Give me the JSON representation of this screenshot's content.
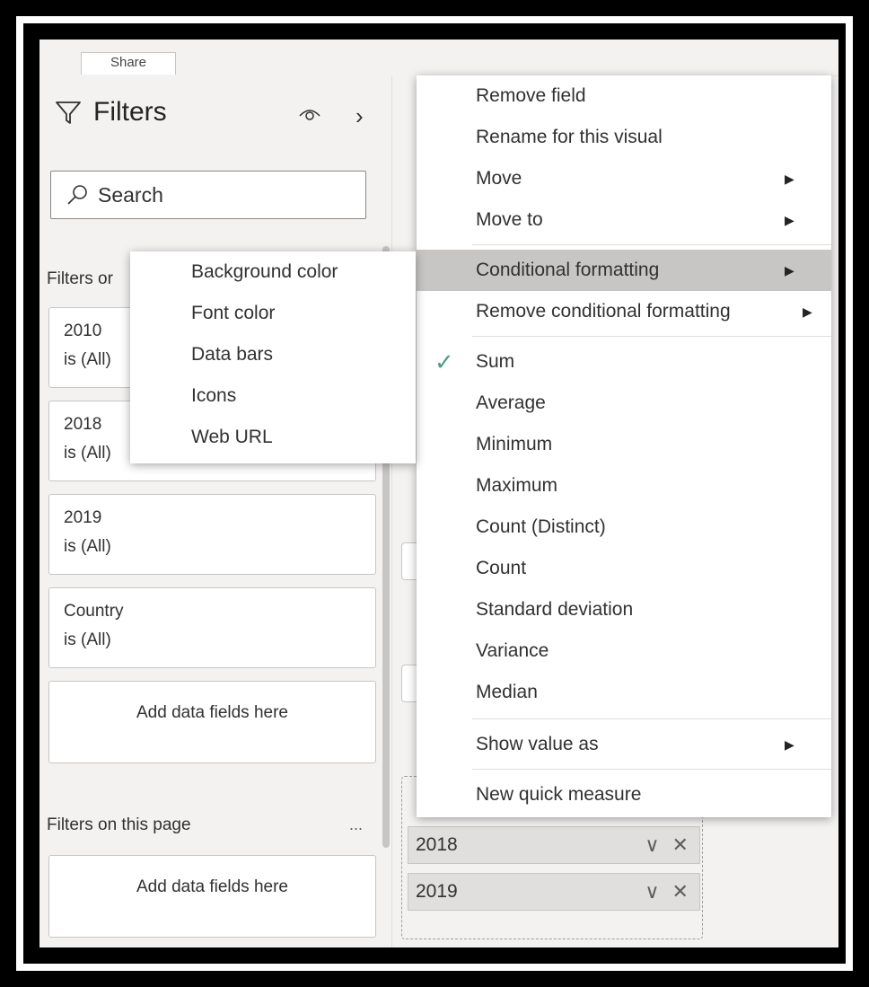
{
  "ribbon": {
    "share_tab": "Share"
  },
  "filters": {
    "title": "Filters",
    "search_placeholder": "Search",
    "section_visual": "Filters on this visual",
    "section_visual_visible": "Filters or",
    "cards": [
      {
        "field": "2010",
        "state": "is (All)"
      },
      {
        "field": "2018",
        "state": "is (All)"
      },
      {
        "field": "2019",
        "state": "is (All)"
      },
      {
        "field": "Country",
        "state": "is (All)"
      }
    ],
    "add_visual": "Add data fields here",
    "section_page": "Filters on this page",
    "page_more": "...",
    "add_page": "Add data fields here"
  },
  "wells": {
    "chips": [
      {
        "label": "2018",
        "ctrls": "∨ ✕"
      },
      {
        "label": "2019",
        "ctrls": "∨ ✕"
      }
    ]
  },
  "menu": {
    "remove_field": "Remove field",
    "rename": "Rename for this visual",
    "move": "Move",
    "move_to": "Move to",
    "conditional_formatting": "Conditional formatting",
    "remove_conditional_formatting": "Remove conditional formatting",
    "sum": "Sum",
    "average": "Average",
    "minimum": "Minimum",
    "maximum": "Maximum",
    "count_distinct": "Count (Distinct)",
    "count": "Count",
    "standard_deviation": "Standard deviation",
    "variance": "Variance",
    "median": "Median",
    "show_value_as": "Show value as",
    "new_quick_measure": "New quick measure",
    "arrow": "▶",
    "check": "✓"
  },
  "submenu": {
    "background_color": "Background color",
    "font_color": "Font color",
    "data_bars": "Data bars",
    "icons": "Icons",
    "web_url": "Web URL"
  },
  "colors": {
    "highlight": "#c8c6c4",
    "check": "#4a9f83",
    "text": "#323130"
  }
}
